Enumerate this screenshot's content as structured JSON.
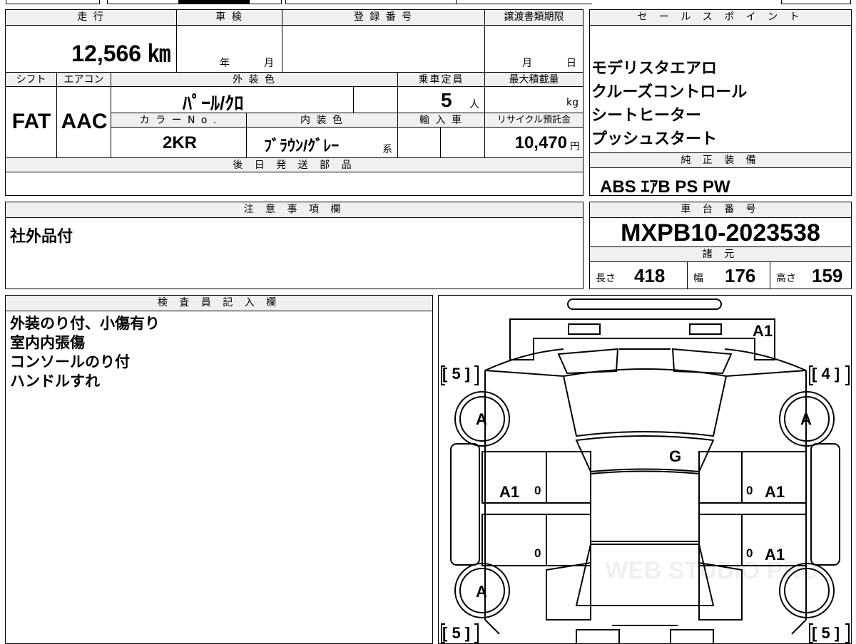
{
  "top_table": {
    "mileage_label": "走 行",
    "mileage_value": "12,566 ㎞",
    "inspection_label": "車 検",
    "inspection_year": "年",
    "inspection_month": "月",
    "registration_label": "登 録 番 号",
    "transfer_label": "譲渡書類期限",
    "transfer_month": "月",
    "transfer_day": "日",
    "shift_label": "シフト",
    "shift_value": "FAT",
    "ac_label": "エアコン",
    "ac_value": "AAC",
    "exterior_label": "外 装 色",
    "exterior_value": "ﾊﾟｰﾙ/ｸﾛ",
    "capacity_label": "乗車定員",
    "capacity_value": "5",
    "capacity_unit": "人",
    "max_load_label": "最大積載量",
    "max_load_unit": "kg",
    "color_no_label": "カ ラ ー N o .",
    "color_no_value": "2KR",
    "interior_label": "内 装 色",
    "interior_value": "ﾌﾞﾗｳﾝ/ｸﾞﾚｰ",
    "interior_suffix": "系",
    "import_label": "輸 入 車",
    "recycle_label": "リサイクル預託金",
    "recycle_value": "10,470",
    "recycle_unit": "円",
    "later_parts_label": "後 日 発 送 部 品"
  },
  "sales_points": {
    "label": "セ ー ル ス ポ イ ン ト",
    "items": [
      "モデリスタエアロ",
      "クルーズコントロール",
      "シートヒーター",
      "プッシュスタート"
    ]
  },
  "standard_equipment": {
    "label": "純 正 装 備",
    "value": "ABS ｴｱB PS PW"
  },
  "notes": {
    "label": "注 意 事 項 欄",
    "text": "社外品付"
  },
  "chassis": {
    "label": "車 台 番 号",
    "value": "MXPB10-2023538"
  },
  "specs": {
    "label": "諸 元",
    "length_label": "長さ",
    "length_value": "418",
    "width_label": "幅",
    "width_value": "176",
    "height_label": "高さ",
    "height_value": "159"
  },
  "inspector": {
    "label": "検 査 員 記 入 欄",
    "lines": [
      "外装のり付、小傷有り",
      "室内内張傷",
      "コンソールのり付",
      "ハンドルすれ"
    ]
  },
  "diagram": {
    "front_bumper_mark": "A1",
    "tire_front_left": "[ 5 ]",
    "tire_front_right": "[ 4 ]",
    "tire_rear_left": "[ 5 ]",
    "tire_rear_right": "[ 5 ]",
    "wheel_front_left": "A",
    "wheel_front_right": "A",
    "wheel_rear_left": "A",
    "windshield_mark": "G",
    "door_front_left": "A1",
    "door_front_right": "A1",
    "door_rear_right": "A1",
    "zero_mark": "0",
    "watermark": "WEB STUDIO PRO"
  }
}
